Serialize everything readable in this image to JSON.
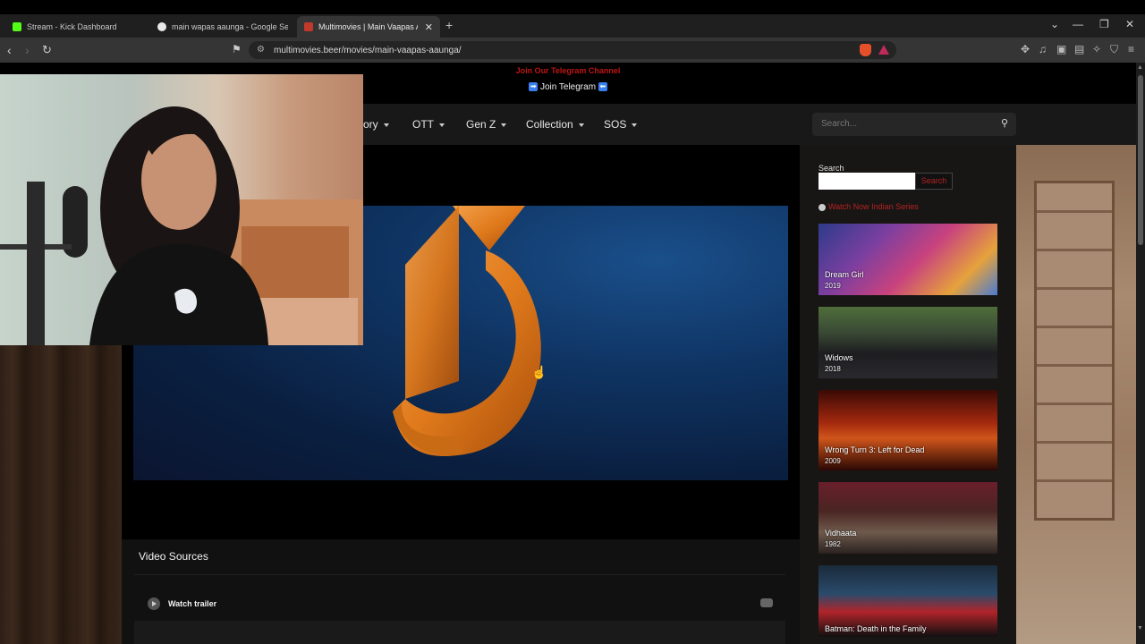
{
  "browser": {
    "tabs": [
      {
        "title": "Stream - Kick Dashboard",
        "favicon_color": "#53fc18",
        "active": false
      },
      {
        "title": "main wapas aaunga - Google Search",
        "favicon_color": "#e8e8e8",
        "active": false
      },
      {
        "title": "Multimovies | Main Vaapas Aaun",
        "favicon_color": "#c0392b",
        "active": true
      }
    ],
    "new_tab_symbol": "+",
    "url": "multimovies.beer/movies/main-vaapas-aaunga/",
    "window_controls": [
      "⌄",
      "—",
      "❐",
      "✕"
    ]
  },
  "site": {
    "telegram_banner": "Join Our Telegram Channel",
    "telegram_link": "Join Telegram",
    "nav": [
      {
        "label": "ory"
      },
      {
        "label": "OTT"
      },
      {
        "label": "Gen Z"
      },
      {
        "label": "Collection"
      },
      {
        "label": "SOS"
      }
    ],
    "search_placeholder": "Search...",
    "sidebar": {
      "search_label": "Search",
      "search_button": "Search",
      "promo_link": "Watch Now Indian Series",
      "movies": [
        {
          "title": "Dream Girl",
          "year": "2019",
          "bg": "linear-gradient(135deg,#2d3b8a 0%,#7a3fa0 30%,#c8427e 55%,#e6a23c 80%,#4a7bd1 100%)"
        },
        {
          "title": "Widows",
          "year": "2018",
          "bg": "linear-gradient(180deg,#4f6e3a 0%,#3a4a35 35%,#1d1d20 65%,#2a2a2e 100%)"
        },
        {
          "title": "Wrong Turn 3: Left for Dead",
          "year": "2009",
          "bg": "linear-gradient(180deg,#3a0a05 0%,#a2280e 40%,#d0551b 60%,#2a0804 100%)"
        },
        {
          "title": "Vidhaata",
          "year": "1982",
          "bg": "linear-gradient(180deg,#6a1f2b 0%,#4a2522 40%,#6e5a4c 70%,#2b2220 100%)"
        },
        {
          "title": "Batman: Death in the Family",
          "year": "",
          "bg": "linear-gradient(180deg,#1a2a3a 0%,#2a4b6b 40%,#b0242a 65%,#101010 100%)"
        }
      ]
    },
    "video_sources_title": "Video Sources",
    "trailer_label": "Watch trailer"
  },
  "colors": {
    "accent_red": "#c01616",
    "player_blue": "#0f3463",
    "logo_orange": "#e07a1c"
  }
}
